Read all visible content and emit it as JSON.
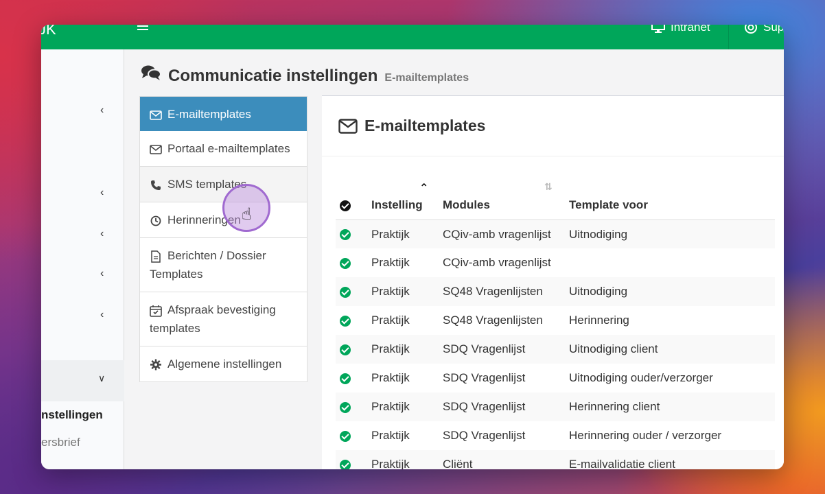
{
  "topbar": {
    "logo_fragment": "JK",
    "nav_intranet": "Intranet",
    "nav_support": "Sup"
  },
  "sidebar": {
    "section_label": "nstellingen",
    "sub_label": "ersbrief"
  },
  "page": {
    "title": "Communicatie instellingen",
    "subtitle": "E-mailtemplates"
  },
  "nav": {
    "items": [
      {
        "label": "E-mailtemplates",
        "icon": "envelope-icon"
      },
      {
        "label": "Portaal e-mailtemplates",
        "icon": "envelope-icon"
      },
      {
        "label": "SMS templates",
        "icon": "phone-icon"
      },
      {
        "label": "Herinneringen",
        "icon": "clock-icon"
      },
      {
        "label": "Berichten / Dossier Templates",
        "icon": "document-icon"
      },
      {
        "label": "Afspraak bevestiging templates",
        "icon": "calendar-icon"
      },
      {
        "label": "Algemene instellingen",
        "icon": "gear-icon"
      }
    ]
  },
  "panel": {
    "title": "E-mailtemplates"
  },
  "table": {
    "headers": [
      "Instelling",
      "Modules",
      "Template voor"
    ],
    "rows": [
      [
        "Praktijk",
        "CQiv-amb vragenlijst",
        "Uitnodiging"
      ],
      [
        "Praktijk",
        "CQiv-amb vragenlijst",
        ""
      ],
      [
        "Praktijk",
        "SQ48 Vragenlijsten",
        "Uitnodiging"
      ],
      [
        "Praktijk",
        "SQ48 Vragenlijsten",
        "Herinnering"
      ],
      [
        "Praktijk",
        "SDQ Vragenlijst",
        "Uitnodiging client"
      ],
      [
        "Praktijk",
        "SDQ Vragenlijst",
        "Uitnodiging ouder/verzorger"
      ],
      [
        "Praktijk",
        "SDQ Vragenlijst",
        "Herinnering client"
      ],
      [
        "Praktijk",
        "SDQ Vragenlijst",
        "Herinnering ouder / verzorger"
      ],
      [
        "Praktijk",
        "Cliënt",
        "E-mailvalidatie client"
      ]
    ]
  },
  "colors": {
    "topbar": "#00a65a",
    "active_nav": "#3c8dbc",
    "check": "#00a65a"
  }
}
